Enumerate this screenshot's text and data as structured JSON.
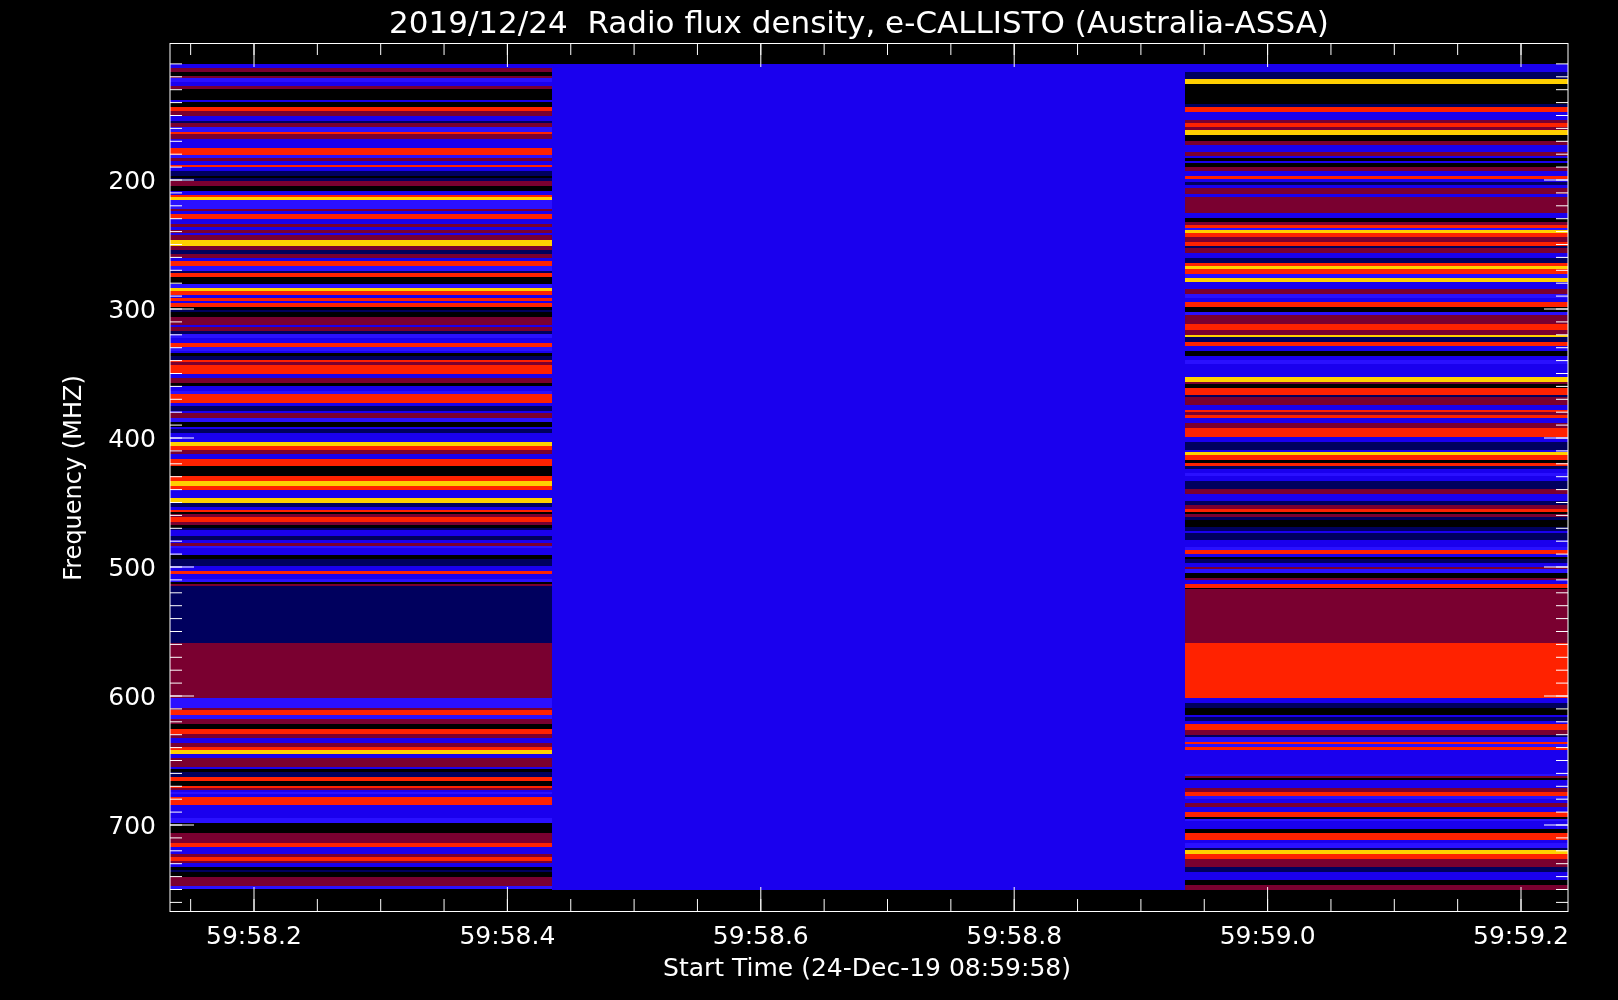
{
  "title": "2019/12/24  Radio flux density, e-CALLISTO (Australia-ASSA)",
  "ylabel": "Frequency (MHZ)",
  "xlabel": "Start Time (24-Dec-19 08:59:58)",
  "yticks": [
    "200",
    "300",
    "400",
    "500",
    "600",
    "700"
  ],
  "xticks": [
    "59:58.2",
    "59:58.4",
    "59:58.6",
    "59:58.8",
    "59:59.0",
    "59:59.2"
  ]
}
